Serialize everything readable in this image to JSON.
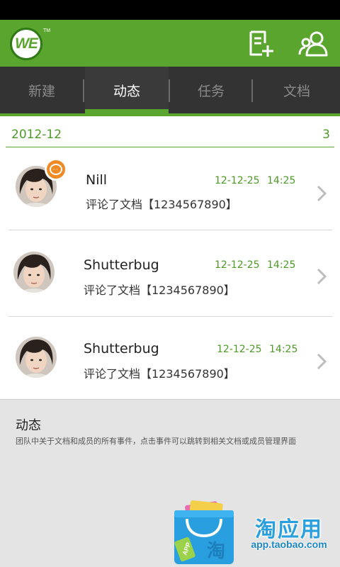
{
  "app": {
    "logo_text": "WE",
    "trademark": "TM"
  },
  "tabs": [
    {
      "label": "新建",
      "active": false
    },
    {
      "label": "动态",
      "active": true
    },
    {
      "label": "任务",
      "active": false
    },
    {
      "label": "文档",
      "active": false
    }
  ],
  "section": {
    "month": "2012-12",
    "count": "3"
  },
  "feed": [
    {
      "name": "Nill",
      "date": "12-12-25",
      "time": "14:25",
      "desc": "评论了文档【1234567890】",
      "has_badge": true
    },
    {
      "name": "Shutterbug",
      "date": "12-12-25",
      "time": "14:25",
      "desc": "评论了文档【1234567890】",
      "has_badge": false
    },
    {
      "name": "Shutterbug",
      "date": "12-12-25",
      "time": "14:25",
      "desc": "评论了文档【1234567890】",
      "has_badge": false
    }
  ],
  "info": {
    "title": "动态",
    "description": "团队中关于文档和成员的所有事件，点击事件可以跳转到相关文档或成员管理界面"
  },
  "watermark": {
    "name": "淘应用",
    "url": "app.taobao.com",
    "bag_label": "淘",
    "tag_label": "APP"
  },
  "colors": {
    "brand_green": "#5aa52d",
    "dark_tab_bar": "#333333",
    "badge_orange": "#f08a24",
    "time_green": "#4d9a26"
  },
  "icons": {
    "new_document": "document-plus-icon",
    "contacts": "people-icon",
    "comment_badge": "chat-bubble-icon",
    "row_arrow": "chevron-right-icon"
  }
}
